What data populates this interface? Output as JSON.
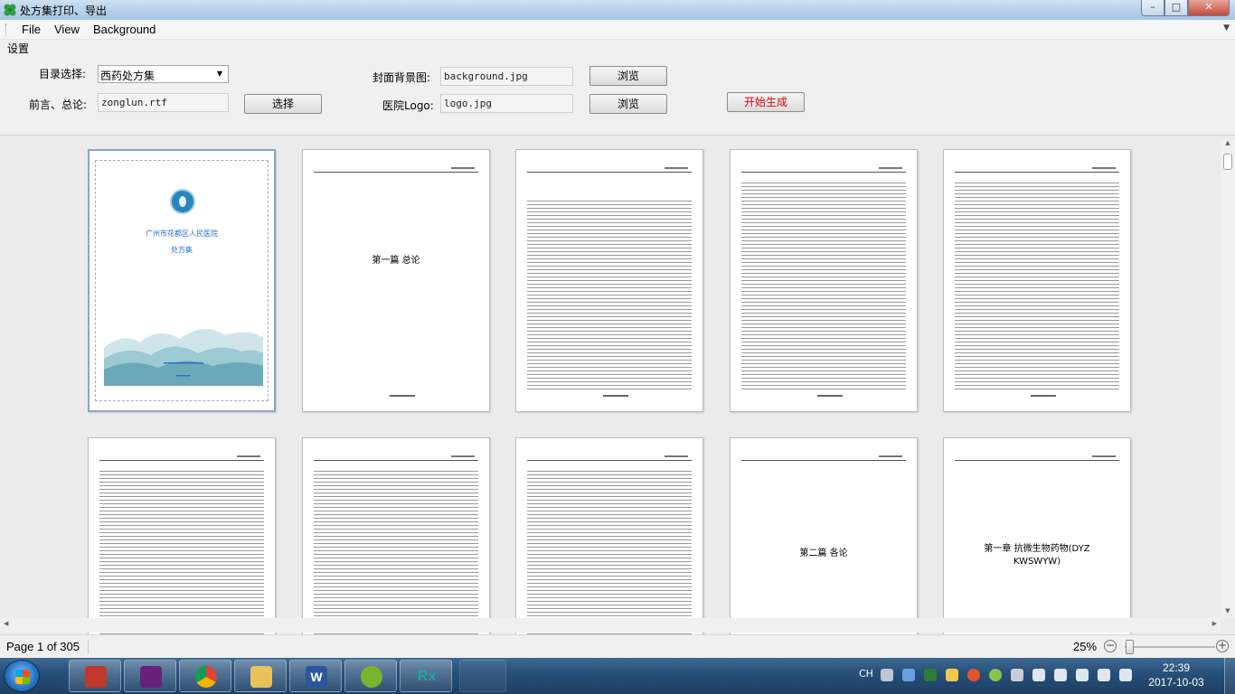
{
  "window": {
    "title": "处方集打印、导出",
    "controls": {
      "minimize": "–",
      "maximize": "□",
      "close": "✕"
    }
  },
  "menu": {
    "items": [
      "File",
      "View",
      "Background"
    ]
  },
  "settings": {
    "legend": "设置",
    "catalog_label": "目录选择:",
    "catalog_value": "西药处方集",
    "preface_label": "前言、总论:",
    "preface_value": "zonglun.rtf",
    "select_button": "选择",
    "cover_bg_label": "封面背景图:",
    "cover_bg_value": "background.jpg",
    "browse_button_1": "浏览",
    "logo_label": "医院Logo:",
    "logo_value": "logo.jpg",
    "browse_button_2": "浏览",
    "generate_button": "开始生成"
  },
  "colors": {
    "generate_text": "#e00000",
    "cover_text": "#2a6fc9",
    "taskbar": "#27507a"
  },
  "preview": {
    "cover": {
      "hospital_name": "广州市花都区人民医院",
      "subtitle": "处方集"
    },
    "page2_title": "第一篇 总论",
    "page9_title": "第二篇 各论",
    "page10_title": "第一章 抗微生物药物(DYZ KWSWYW)"
  },
  "status": {
    "page_info": "Page 1 of 305",
    "zoom": "25%",
    "zoom_out": "−",
    "zoom_in": "+",
    "zoom_fraction": 0.25
  },
  "taskbar": {
    "apps": [
      {
        "name": "toolbox-app-icon"
      },
      {
        "name": "visual-studio-icon"
      },
      {
        "name": "chrome-icon"
      },
      {
        "name": "file-explorer-icon"
      },
      {
        "name": "word-icon",
        "label": "W"
      },
      {
        "name": "wechat-icon"
      },
      {
        "name": "rx-app-icon",
        "label": "Rx"
      }
    ],
    "ime": "CH",
    "time": "22:39",
    "date": "2017-10-03"
  }
}
